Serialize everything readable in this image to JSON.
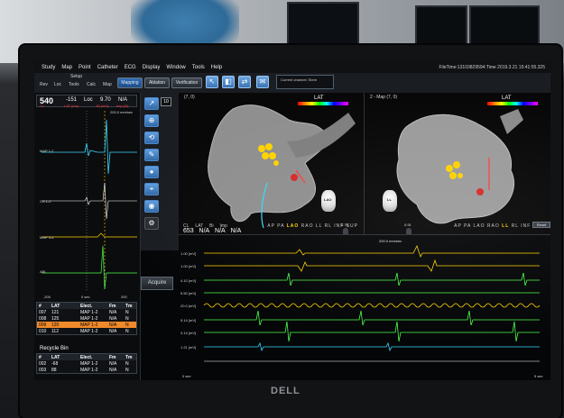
{
  "menu": [
    "Study",
    "Map",
    "Point",
    "Catheter",
    "ECG",
    "Display",
    "Window",
    "Tools",
    "Help"
  ],
  "file_info": "FileTime:13103829594:Time 2019.3.21 15:41:55.325",
  "toolbar": {
    "setup_label": "Setup",
    "small_tabs": [
      "Rev",
      "Loc",
      "Tools",
      "Calc",
      "Map"
    ],
    "mapping": "Mapping",
    "ablation": "Ablation",
    "verification": "Verification",
    "channel": "Current channel: Stem"
  },
  "left": {
    "main": "540",
    "values": [
      "-151",
      "Loc",
      "9.70",
      "N/A"
    ],
    "subs": [
      "CL",
      "LAT (ms)",
      "Bi (mV)",
      "Imp (Ω)"
    ],
    "speed": "200.0 mm/sec",
    "traces": [
      "MAP 1-2",
      "CS 1-2",
      "MAP 3-4",
      "ABL"
    ],
    "axis_left": "-200",
    "axis_mid": "0 sec",
    "axis_right": "200",
    "table_headers": [
      "#",
      "LAT",
      "Elect.",
      "Fm",
      "Tm"
    ],
    "table_rows": [
      {
        "n": "007",
        "lat": "121",
        "elect": "MAP 1-2",
        "fm": "N/A",
        "tm": "N"
      },
      {
        "n": "008",
        "lat": "125",
        "elect": "MAP 1-2",
        "fm": "N/A",
        "tm": "N"
      },
      {
        "n": "009",
        "lat": "120",
        "elect": "MAP 1-2",
        "fm": "N/A",
        "tm": "N"
      },
      {
        "n": "010",
        "lat": "112",
        "elect": "MAP 1-2",
        "fm": "N/A",
        "tm": "N"
      }
    ],
    "recycle_title": "Recycle Bin",
    "recycle_rows": [
      {
        "n": "002",
        "lat": "-68",
        "elect": "MAP 1-2",
        "fm": "N/A",
        "tm": "N"
      },
      {
        "n": "003",
        "lat": "88",
        "elect": "MAP 1-2",
        "fm": "N/A",
        "tm": "N"
      }
    ]
  },
  "tools": {
    "num": "10",
    "acquire": "Acquire"
  },
  "map1": {
    "title": "(7, 0)",
    "lat": "LAT",
    "bottom_labels": [
      "CL",
      "LAT",
      "Bi",
      "Imp"
    ],
    "bottom_values": [
      "653",
      "N/A",
      "N/A",
      "N/A"
    ],
    "views": [
      "AP",
      "PA",
      "LAO",
      "RAO",
      "LL",
      "RL",
      "INF",
      "SUP"
    ],
    "active_view": "LAO",
    "slider_vals": [
      "0.75",
      "0"
    ],
    "orient": "LAO"
  },
  "map2": {
    "title": "2 - Map (7, 0)",
    "lat": "LAT",
    "views": [
      "AP",
      "PA",
      "LAO",
      "RAO",
      "LL",
      "RL",
      "INF",
      "SUP"
    ],
    "active_view": "LL",
    "slider_vals": [
      "0.91",
      "0"
    ],
    "orient": "LL",
    "button": "Reset"
  },
  "signal": {
    "speed": "200.0 mm/sec",
    "labels": [
      "1.00 [mV]",
      "1.00 [mV]",
      "4.10 [mV]",
      "5.50 [mV]",
      "20.0 [mV]",
      "5.14 [mV]",
      "3.14 [mV]",
      "1.21 [mV]"
    ],
    "bottom_left": "0 sec",
    "bottom_right": "5 sec"
  },
  "background": {
    "logo": "DELL"
  },
  "colors": {
    "accent": "#2f6fb8",
    "selected_row": "#f08a2b",
    "trace_cyan": "#3ad7ff",
    "trace_yellow": "#ffd200",
    "trace_green": "#4cff4c"
  }
}
